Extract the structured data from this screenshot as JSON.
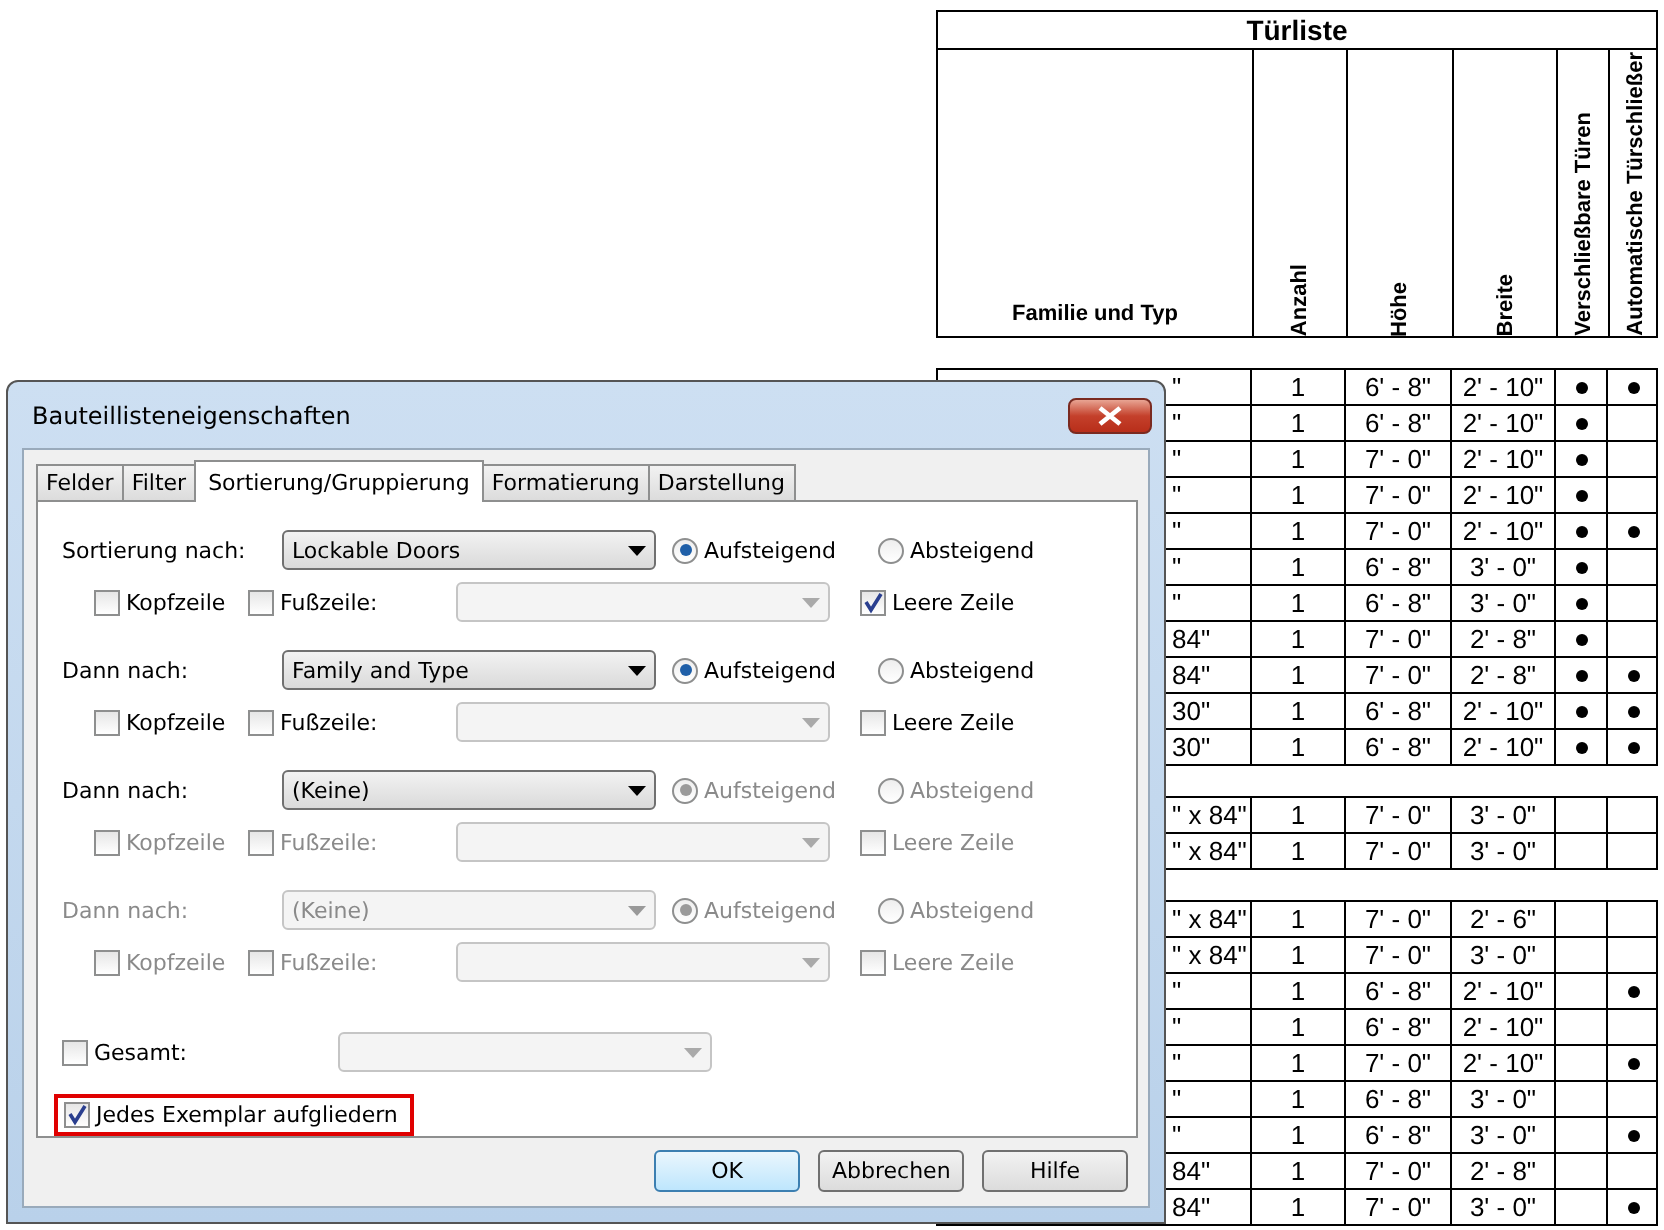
{
  "schedule": {
    "title": "Türliste",
    "columns": [
      {
        "label": "Familie und Typ",
        "vertical": false
      },
      {
        "label": "Anzahl",
        "vertical": true
      },
      {
        "label": "Höhe",
        "vertical": true
      },
      {
        "label": "Breite",
        "vertical": true
      },
      {
        "label": "Verschließbare Türen",
        "vertical": true
      },
      {
        "label": "Automatische Türschließer",
        "vertical": true
      }
    ],
    "groups": [
      {
        "rows": [
          {
            "family": "\"",
            "count": "1",
            "height": "6' - 8\"",
            "width": "2' - 10\"",
            "lockable": true,
            "closer": true
          },
          {
            "family": "\"",
            "count": "1",
            "height": "6' - 8\"",
            "width": "2' - 10\"",
            "lockable": true,
            "closer": false
          },
          {
            "family": "\"",
            "count": "1",
            "height": "7' - 0\"",
            "width": "2' - 10\"",
            "lockable": true,
            "closer": false
          },
          {
            "family": "\"",
            "count": "1",
            "height": "7' - 0\"",
            "width": "2' - 10\"",
            "lockable": true,
            "closer": false
          },
          {
            "family": "\"",
            "count": "1",
            "height": "7' - 0\"",
            "width": "2' - 10\"",
            "lockable": true,
            "closer": true
          },
          {
            "family": "\"",
            "count": "1",
            "height": "6' - 8\"",
            "width": "3' - 0\"",
            "lockable": true,
            "closer": false
          },
          {
            "family": "\"",
            "count": "1",
            "height": "6' - 8\"",
            "width": "3' - 0\"",
            "lockable": true,
            "closer": false
          },
          {
            "family": "84\"",
            "count": "1",
            "height": "7' - 0\"",
            "width": "2' - 8\"",
            "lockable": true,
            "closer": false
          },
          {
            "family": "84\"",
            "count": "1",
            "height": "7' - 0\"",
            "width": "2' - 8\"",
            "lockable": true,
            "closer": true
          },
          {
            "family": "30\"",
            "count": "1",
            "height": "6' - 8\"",
            "width": "2' - 10\"",
            "lockable": true,
            "closer": true
          },
          {
            "family": "30\"",
            "count": "1",
            "height": "6' - 8\"",
            "width": "2' - 10\"",
            "lockable": true,
            "closer": true
          }
        ]
      },
      {
        "rows": [
          {
            "family": "\" x 84\"",
            "count": "1",
            "height": "7' - 0\"",
            "width": "3' - 0\"",
            "lockable": false,
            "closer": false
          },
          {
            "family": "\" x 84\"",
            "count": "1",
            "height": "7' - 0\"",
            "width": "3' - 0\"",
            "lockable": false,
            "closer": false
          }
        ]
      },
      {
        "rows": [
          {
            "family": "\" x 84\"",
            "count": "1",
            "height": "7' - 0\"",
            "width": "2' - 6\"",
            "lockable": false,
            "closer": false
          },
          {
            "family": "\" x 84\"",
            "count": "1",
            "height": "7' - 0\"",
            "width": "3' - 0\"",
            "lockable": false,
            "closer": false
          },
          {
            "family": "\"",
            "count": "1",
            "height": "6' - 8\"",
            "width": "2' - 10\"",
            "lockable": false,
            "closer": true
          },
          {
            "family": "\"",
            "count": "1",
            "height": "6' - 8\"",
            "width": "2' - 10\"",
            "lockable": false,
            "closer": false
          },
          {
            "family": "\"",
            "count": "1",
            "height": "7' - 0\"",
            "width": "2' - 10\"",
            "lockable": false,
            "closer": true
          },
          {
            "family": "\"",
            "count": "1",
            "height": "6' - 8\"",
            "width": "3' - 0\"",
            "lockable": false,
            "closer": false
          },
          {
            "family": "\"",
            "count": "1",
            "height": "6' - 8\"",
            "width": "3' - 0\"",
            "lockable": false,
            "closer": true
          },
          {
            "family": "84\"",
            "count": "1",
            "height": "7' - 0\"",
            "width": "2' - 8\"",
            "lockable": false,
            "closer": false
          },
          {
            "family": "84\"",
            "count": "1",
            "height": "7' - 0\"",
            "width": "3' - 0\"",
            "lockable": false,
            "closer": true
          }
        ]
      }
    ]
  },
  "dialog": {
    "title": "Bauteillisteneigenschaften",
    "tabs": [
      {
        "label": "Felder",
        "selected": false
      },
      {
        "label": "Filter",
        "selected": false
      },
      {
        "label": "Sortierung/Gruppierung",
        "selected": true
      },
      {
        "label": "Formatierung",
        "selected": false
      },
      {
        "label": "Darstellung",
        "selected": false
      }
    ],
    "sort_levels": [
      {
        "label": "Sortierung nach:",
        "disabled": false,
        "field": "Lockable Doors",
        "options_disabled": false,
        "order": [
          {
            "label": "Aufsteigend",
            "selected": true
          },
          {
            "label": "Absteigend",
            "selected": false
          }
        ],
        "header": {
          "label": "Kopfzeile",
          "checked": false
        },
        "footer": {
          "label": "Fußzeile:",
          "checked": false
        },
        "blank_line": {
          "label": "Leere Zeile",
          "checked": true
        }
      },
      {
        "label": "Dann nach:",
        "disabled": false,
        "field": "Family and Type",
        "options_disabled": false,
        "order": [
          {
            "label": "Aufsteigend",
            "selected": true
          },
          {
            "label": "Absteigend",
            "selected": false
          }
        ],
        "header": {
          "label": "Kopfzeile",
          "checked": false
        },
        "footer": {
          "label": "Fußzeile:",
          "checked": false
        },
        "blank_line": {
          "label": "Leere Zeile",
          "checked": false
        }
      },
      {
        "label": "Dann nach:",
        "disabled": false,
        "field": "(Keine)",
        "options_disabled": true,
        "order": [
          {
            "label": "Aufsteigend",
            "selected": true
          },
          {
            "label": "Absteigend",
            "selected": false
          }
        ],
        "header": {
          "label": "Kopfzeile",
          "checked": false
        },
        "footer": {
          "label": "Fußzeile:",
          "checked": false
        },
        "blank_line": {
          "label": "Leere Zeile",
          "checked": false
        }
      },
      {
        "label": "Dann nach:",
        "disabled": true,
        "field": "(Keine)",
        "options_disabled": true,
        "order": [
          {
            "label": "Aufsteigend",
            "selected": true
          },
          {
            "label": "Absteigend",
            "selected": false
          }
        ],
        "header": {
          "label": "Kopfzeile",
          "checked": false
        },
        "footer": {
          "label": "Fußzeile:",
          "checked": false
        },
        "blank_line": {
          "label": "Leere Zeile",
          "checked": false
        }
      }
    ],
    "total": {
      "label": "Gesamt:",
      "checked": false
    },
    "itemize": {
      "label": "Jedes Exemplar aufgliedern",
      "checked": true,
      "highlighted": true
    },
    "buttons": [
      {
        "label": "OK",
        "default": true
      },
      {
        "label": "Abbrechen",
        "default": false
      },
      {
        "label": "Hilfe",
        "default": false
      }
    ]
  }
}
